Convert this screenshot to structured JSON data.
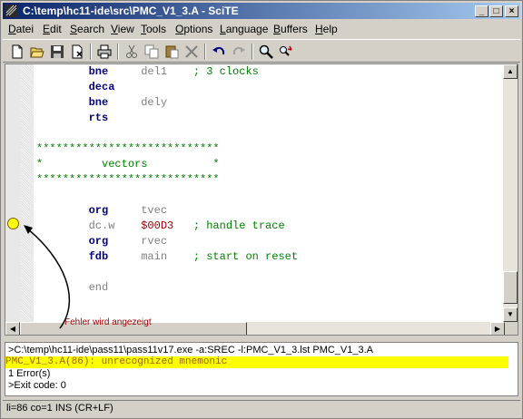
{
  "window": {
    "title": "C:\\temp\\hc11-ide\\src\\PMC_V1_3.A - SciTE",
    "min_label": "_",
    "max_label": "□",
    "close_label": "×"
  },
  "menu": [
    {
      "pre": "",
      "ul": "D",
      "post": "atei"
    },
    {
      "pre": "",
      "ul": "E",
      "post": "dit"
    },
    {
      "pre": "",
      "ul": "S",
      "post": "earch"
    },
    {
      "pre": "",
      "ul": "V",
      "post": "iew"
    },
    {
      "pre": "",
      "ul": "T",
      "post": "ools"
    },
    {
      "pre": "",
      "ul": "O",
      "post": "ptions"
    },
    {
      "pre": "",
      "ul": "L",
      "post": "anguage"
    },
    {
      "pre": "",
      "ul": "B",
      "post": "uffers"
    },
    {
      "pre": "",
      "ul": "H",
      "post": "elp"
    }
  ],
  "toolbar_icons": [
    "new-file-icon",
    "open-file-icon",
    "save-icon",
    "close-file-icon",
    "print-icon",
    "cut-icon",
    "copy-icon",
    "paste-icon",
    "delete-icon",
    "undo-icon",
    "redo-icon",
    "find-icon",
    "replace-icon"
  ],
  "code": [
    {
      "op": "bne",
      "arg": "del1",
      "comment": "; 3 clocks"
    },
    {
      "op": "deca",
      "arg": "",
      "comment": ""
    },
    {
      "op": "bne",
      "arg": "dely",
      "comment": ""
    },
    {
      "op": "rts",
      "arg": "",
      "comment": ""
    },
    {
      "op": "",
      "arg": "",
      "comment": ""
    },
    {
      "full": "****************************"
    },
    {
      "full": "*         vectors          *"
    },
    {
      "full": "****************************"
    },
    {
      "op": "",
      "arg": "",
      "comment": ""
    },
    {
      "op": "org",
      "arg": "tvec",
      "comment": ""
    },
    {
      "op": "dc.w",
      "arg": "$00D3",
      "comment": "; handle trace",
      "argnum": true,
      "opgray": true
    },
    {
      "op": "org",
      "arg": "rvec",
      "comment": ""
    },
    {
      "op": "fdb",
      "arg": "main",
      "comment": "; start on reset"
    },
    {
      "op": "",
      "arg": "",
      "comment": ""
    },
    {
      "op": "end",
      "arg": "",
      "comment": "",
      "opgray": true
    }
  ],
  "annotation": "Fehler wird angezeigt",
  "output": {
    "command": ">C:\\temp\\hc11-ide\\pass11\\pass11v17.exe -a:SREC -l:PMC_V1_3.lst PMC_V1_3.A",
    "error": "PMC_V1_3.A(86): unrecognized mnemonic",
    "count": "1 Error(s)",
    "exit": ">Exit code: 0"
  },
  "status": "li=86 co=1 INS (CR+LF)"
}
